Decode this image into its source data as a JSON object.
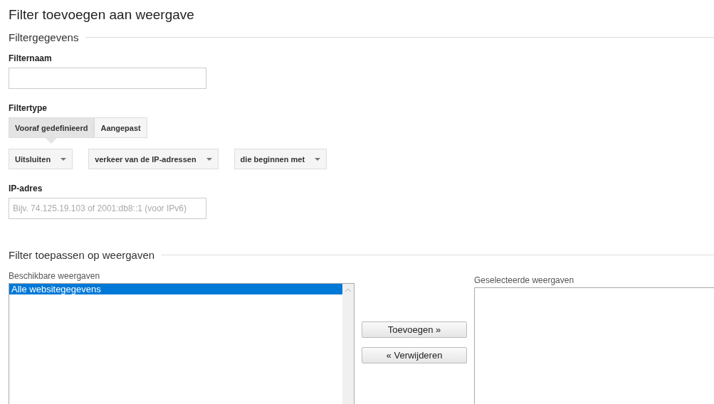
{
  "title": "Filter toevoegen aan weergave",
  "details": {
    "heading": "Filtergegevens",
    "name_label": "Filternaam",
    "type_label": "Filtertype",
    "type_tabs": [
      {
        "label": "Vooraf gedefinieerd",
        "selected": true
      },
      {
        "label": "Aangepast",
        "selected": false
      }
    ],
    "dropdowns": [
      "Uitsluiten",
      "verkeer van de IP-adressen",
      "die beginnen met"
    ],
    "ip_label": "IP-adres",
    "ip_placeholder": "Bijv. 74.125.19.103 of 2001:db8::1 (voor IPv6)"
  },
  "apply": {
    "heading": "Filter toepassen op weergaven",
    "available_label": "Beschikbare weergaven",
    "available": [
      {
        "label": "Alle websitegegevens",
        "selected": true
      }
    ],
    "add_button": "Toevoegen »",
    "remove_button": "« Verwijderen",
    "selected_label": "Geselecteerde weergaven"
  }
}
